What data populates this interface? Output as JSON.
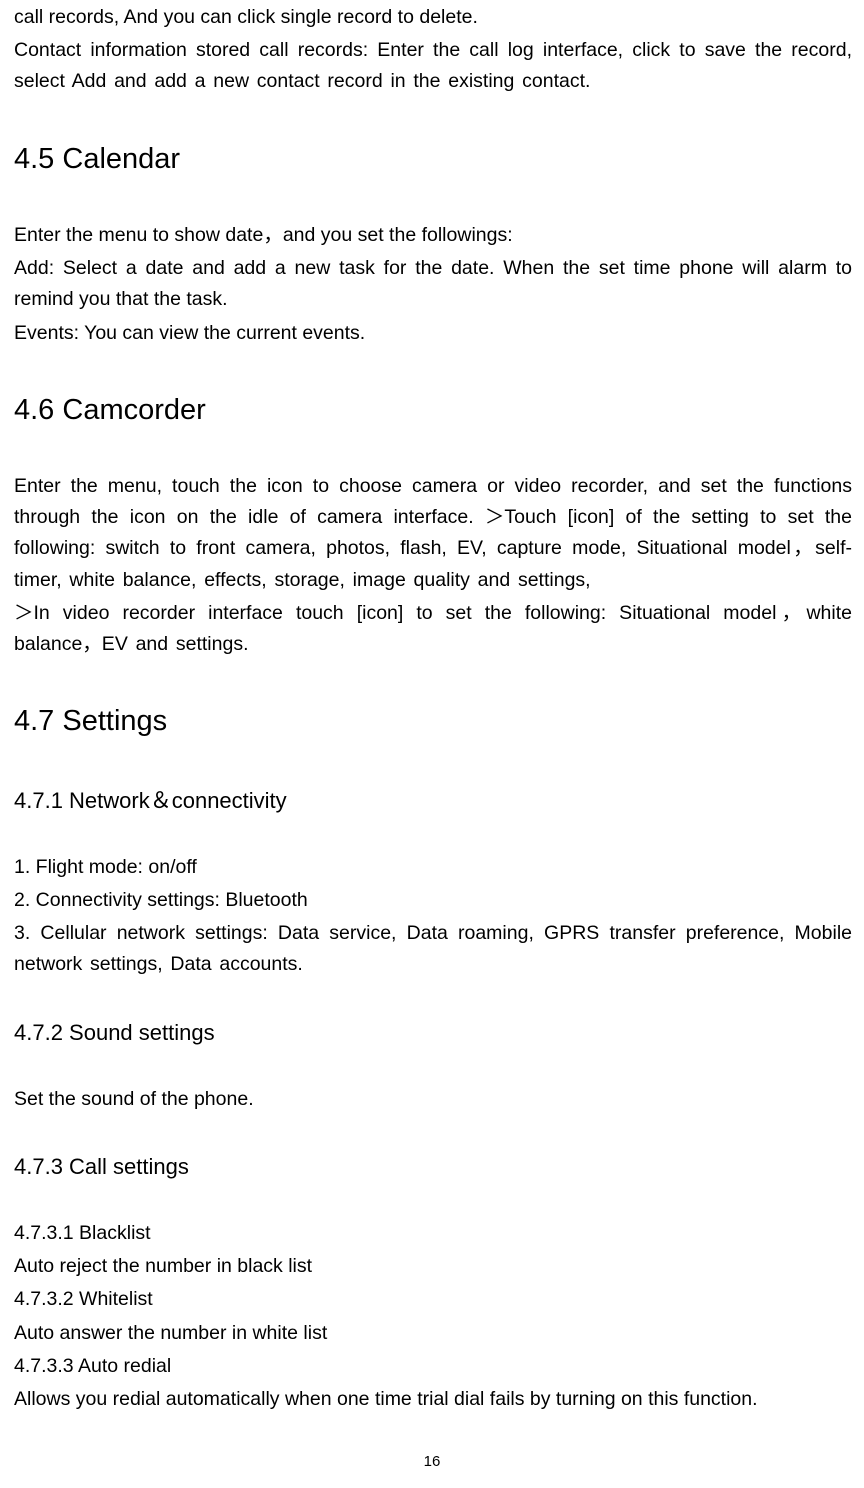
{
  "intro": {
    "p1": "call records, And you can click single record to delete.",
    "p2": "Contact information stored call records: Enter the call log interface, click to save the record, select Add and add a new contact record in the existing contact."
  },
  "s45": {
    "heading": "4.5 Calendar",
    "p1": "Enter the menu to show date，and you set the followings:",
    "p2": "Add: Select a date and add a new task for the date. When the set time phone will alarm to remind you that the task.",
    "p3": "Events: You can view the current events."
  },
  "s46": {
    "heading": "4.6 Camcorder",
    "p1": "Enter the menu, touch the icon to choose camera or video recorder,   and set the functions through the icon on the idle of camera interface. ＞Touch [icon] of the setting to set the following: switch to front camera, photos, flash, EV, capture mode, Situational model，self-timer, white balance, effects, storage, image quality and settings,",
    "p2": "＞In video recorder interface touch [icon] to set the following: Situational model，white balance，EV and settings."
  },
  "s47": {
    "heading": "4.7 Settings",
    "s471": {
      "heading": "4.7.1 Network＆connectivity",
      "p1": "1. Flight mode: on/off",
      "p2": "2. Connectivity settings: Bluetooth",
      "p3": "3. Cellular network settings: Data service, Data roaming, GPRS transfer preference, Mobile network settings, Data accounts."
    },
    "s472": {
      "heading": "4.7.2 Sound settings",
      "p1": "Set the sound of the phone."
    },
    "s473": {
      "heading": "4.7.3 Call settings",
      "p1": "4.7.3.1 Blacklist",
      "p2": "Auto reject the number in black list",
      "p3": "4.7.3.2 Whitelist",
      "p4": "Auto answer the number in white list",
      "p5": "4.7.3.3 Auto redial",
      "p6": "Allows you redial automatically when one time trial dial fails by turning on this function."
    }
  },
  "page_number": "16"
}
